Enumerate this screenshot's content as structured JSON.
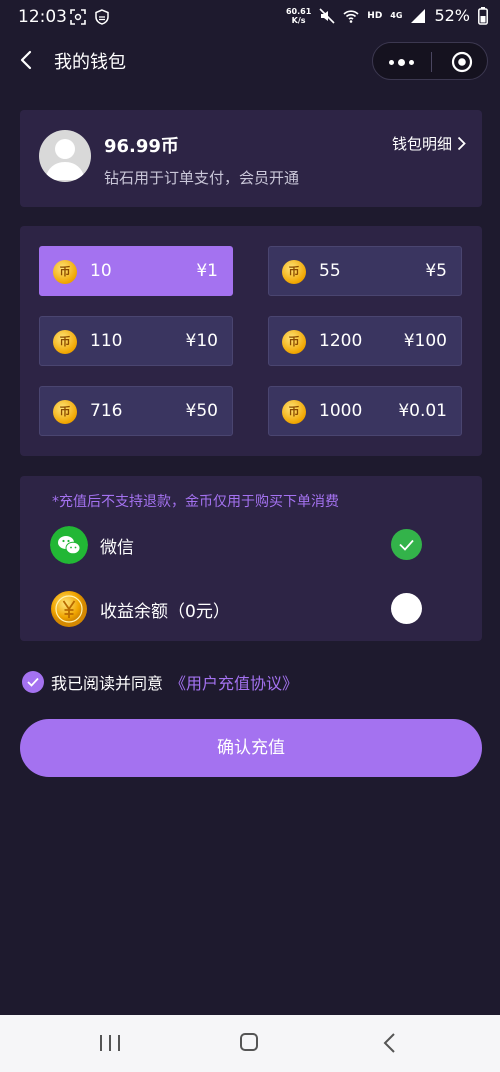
{
  "status_bar": {
    "time": "12:03",
    "net_speed_value": "60.61",
    "net_speed_unit": "K/s",
    "hd": "HD",
    "network": "4G",
    "battery": "52%"
  },
  "nav": {
    "title": "我的钱包"
  },
  "wallet": {
    "balance": "96.99币",
    "description": "钻石用于订单支付，会员开通",
    "detail_link": "钱包明细"
  },
  "coin_glyph": "币",
  "options": [
    {
      "coins": "10",
      "price": "¥1",
      "selected": true
    },
    {
      "coins": "55",
      "price": "¥5",
      "selected": false
    },
    {
      "coins": "110",
      "price": "¥10",
      "selected": false
    },
    {
      "coins": "1200",
      "price": "¥100",
      "selected": false
    },
    {
      "coins": "716",
      "price": "¥50",
      "selected": false
    },
    {
      "coins": "1000",
      "price": "¥0.01",
      "selected": false
    }
  ],
  "payment": {
    "notice": "*充值后不支持退款，金币仅用于购买下单消费",
    "methods": [
      {
        "label": "微信",
        "icon": "wechat-icon",
        "selected": true
      },
      {
        "label": "收益余额（0元）",
        "icon": "yuan-coin-icon",
        "selected": false
      }
    ]
  },
  "agreement": {
    "checked": true,
    "text": "我已阅读并同意",
    "link": "《用户充值协议》"
  },
  "confirm_button": "确认充值",
  "colors": {
    "background": "#1e1a2e",
    "card": "#2d2445",
    "accent": "#a472f0",
    "option": "#3a3560",
    "wechat_green": "#33b34a"
  }
}
